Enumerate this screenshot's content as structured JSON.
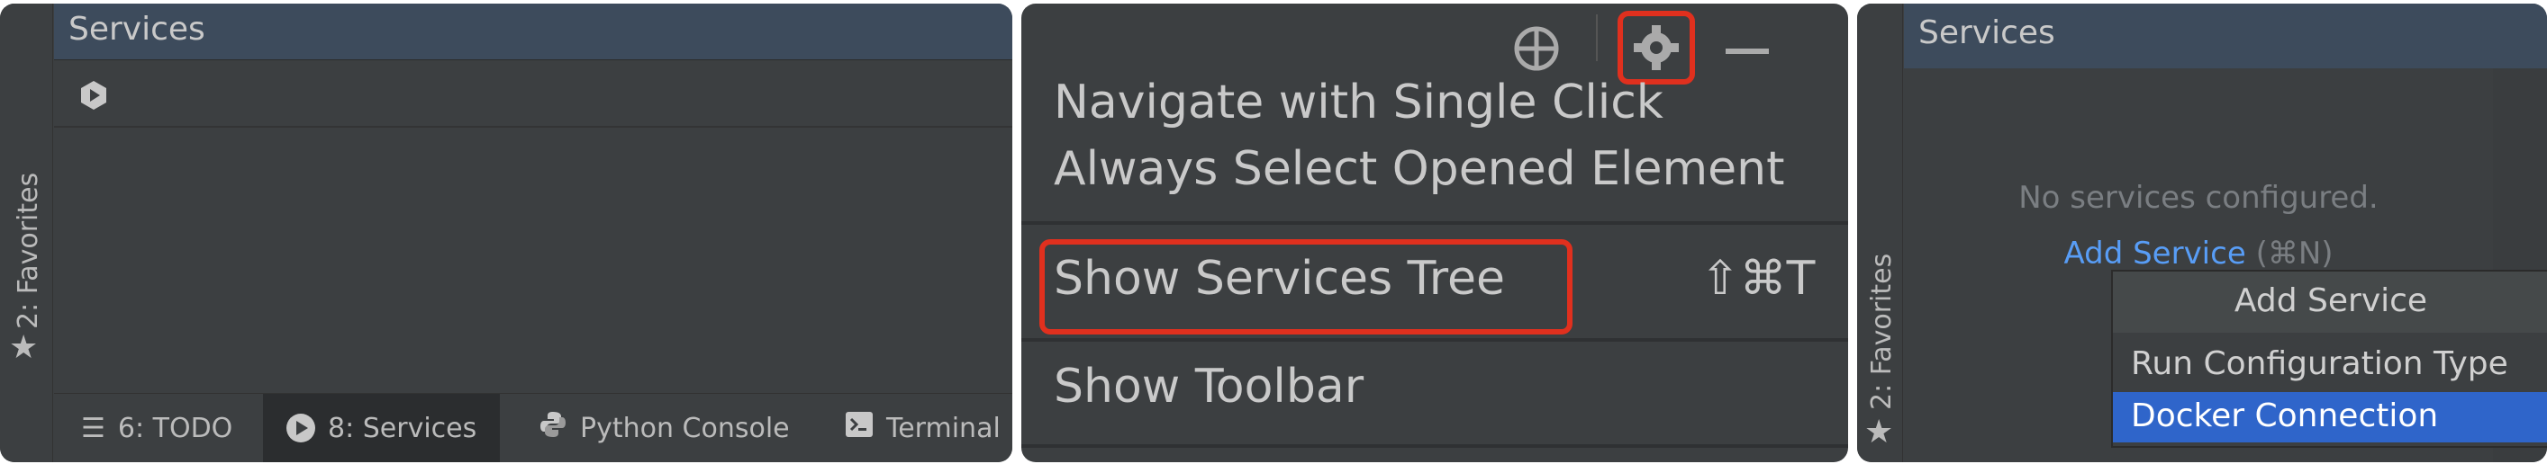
{
  "panel1": {
    "strip_label": "2: Favorites",
    "header_title": "Services",
    "bottom_tabs": [
      {
        "label": "6: TODO",
        "icon": "list-icon"
      },
      {
        "label": "8: Services",
        "icon": "run-icon"
      },
      {
        "label": "Python Console",
        "icon": "python-icon"
      },
      {
        "label": "Terminal",
        "icon": "terminal-icon"
      }
    ]
  },
  "panel2": {
    "menu": [
      {
        "label": "Navigate with Single Click"
      },
      {
        "label": "Always Select Opened Element"
      },
      {
        "label": "Show Services Tree",
        "shortcut": "⇧⌘T"
      },
      {
        "label": "Show Toolbar"
      }
    ],
    "highlight_color": "#e0301e"
  },
  "panel3": {
    "strip_label": "2: Favorites",
    "header_title": "Services",
    "empty_text": "No services configured.",
    "add_link": "Add Service",
    "add_shortcut": "(⌘N)",
    "popup": {
      "title": "Add Service",
      "items": [
        "Run Configuration Type",
        "Docker Connection"
      ]
    },
    "accent_color": "#2f65ca"
  }
}
